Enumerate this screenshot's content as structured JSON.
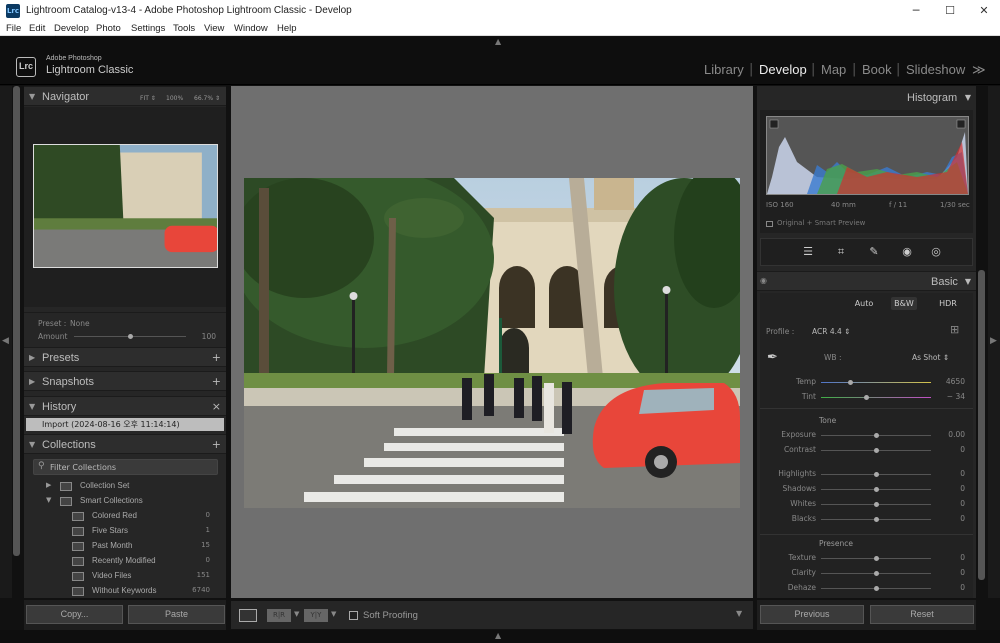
{
  "window": {
    "app_icon": "Lrc",
    "title": "Lightroom Catalog-v13-4 - Adobe Photoshop Lightroom Classic - Develop",
    "minimize": "─",
    "maximize": "☐",
    "close": "✕"
  },
  "menu": [
    "File",
    "Edit",
    "Develop",
    "Photo",
    "Settings",
    "Tools",
    "View",
    "Window",
    "Help"
  ],
  "brand": {
    "logo": "Lrc",
    "line1": "Adobe Photoshop",
    "line2": "Lightroom Classic"
  },
  "modules": [
    "Library",
    "Develop",
    "Map",
    "Book",
    "Slideshow"
  ],
  "modules_more": "≫",
  "left": {
    "navigator": {
      "title": "Navigator",
      "opt1": "FIT ⇕",
      "opt2": "100%",
      "opt3": "66.7% ⇕"
    },
    "preset": {
      "label": "Preset :",
      "value": "None",
      "amount_label": "Amount",
      "amount_value": "100",
      "amount_level": 0.5
    },
    "presets": {
      "title": "Presets",
      "action": "+"
    },
    "snapshots": {
      "title": "Snapshots",
      "action": "+"
    },
    "history": {
      "title": "History",
      "action": "×",
      "item": "Import (2024-08-16 오후 11:14:14)"
    },
    "collections": {
      "title": "Collections",
      "action": "+",
      "filter": "Filter Collections",
      "collection_set": "Collection Set",
      "smart_collections": "Smart Collections",
      "items": [
        {
          "name": "Colored Red",
          "count": "0"
        },
        {
          "name": "Five Stars",
          "count": "1"
        },
        {
          "name": "Past Month",
          "count": "15"
        },
        {
          "name": "Recently Modified",
          "count": "0"
        },
        {
          "name": "Video Files",
          "count": "151"
        },
        {
          "name": "Without Keywords",
          "count": "6740"
        }
      ]
    },
    "copy_button": "Copy...",
    "paste_button": "Paste"
  },
  "toolbar": {
    "soft_proofing": "Soft Proofing",
    "ry": "R|R",
    "yy": "Y|Y"
  },
  "right": {
    "histogram": {
      "title": "Histogram",
      "iso": "ISO 160",
      "focal": "40 mm",
      "aperture": "f / 11",
      "shutter": "1/30 sec",
      "preview": "Original + Smart Preview"
    },
    "basic": {
      "title": "Basic",
      "auto": "Auto",
      "bw": "B&W",
      "hdr": "HDR",
      "profile_label": "Profile :",
      "profile_value": "ACR 4.4 ⇕",
      "wb_label": "WB :",
      "wb_value": "As Shot ⇕",
      "temp": {
        "label": "Temp",
        "value": "4650",
        "level": 0.27
      },
      "tint": {
        "label": "Tint",
        "value": "− 34",
        "level": 0.41
      },
      "tone_label": "Tone",
      "tone": [
        {
          "label": "Exposure",
          "value": "0.00",
          "level": 0.5
        },
        {
          "label": "Contrast",
          "value": "0",
          "level": 0.5
        }
      ],
      "tone2": [
        {
          "label": "Highlights",
          "value": "0",
          "level": 0.5
        },
        {
          "label": "Shadows",
          "value": "0",
          "level": 0.5
        },
        {
          "label": "Whites",
          "value": "0",
          "level": 0.5
        },
        {
          "label": "Blacks",
          "value": "0",
          "level": 0.5
        }
      ],
      "presence_label": "Presence",
      "presence": [
        {
          "label": "Texture",
          "value": "0",
          "level": 0.5
        },
        {
          "label": "Clarity",
          "value": "0",
          "level": 0.5
        },
        {
          "label": "Dehaze",
          "value": "0",
          "level": 0.5
        }
      ]
    },
    "previous_button": "Previous",
    "reset_button": "Reset"
  },
  "colors": {
    "accent": "#eeeeee",
    "panel": "#262626",
    "canvas": "#6f6f6f",
    "photo_car": "#e8463a"
  }
}
